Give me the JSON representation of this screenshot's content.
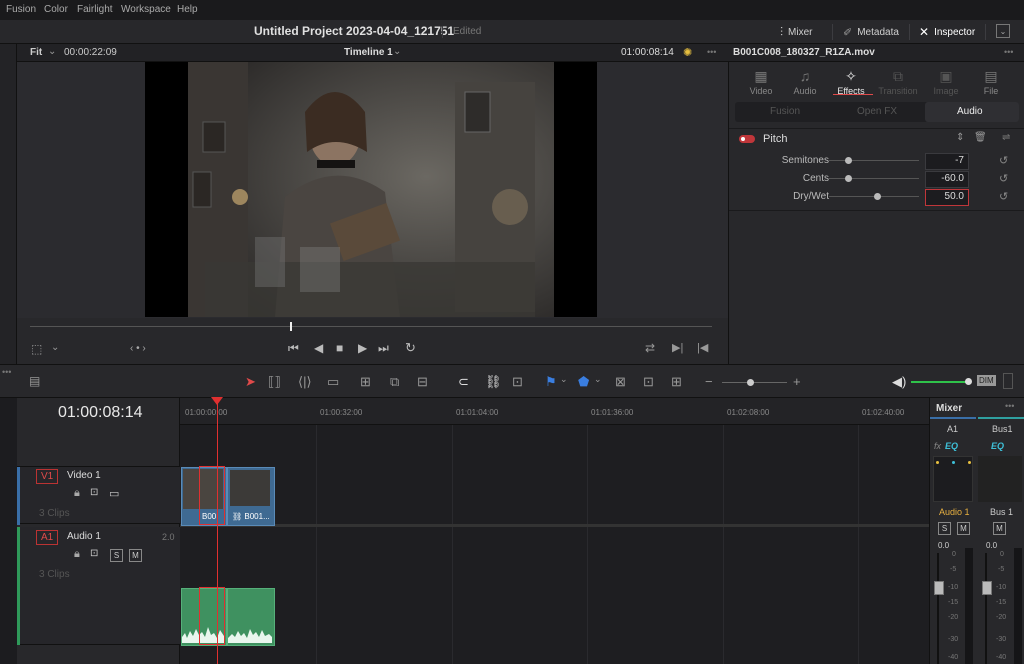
{
  "menu": [
    "Fusion",
    "Color",
    "Fairlight",
    "Workspace",
    "Help"
  ],
  "project": {
    "title": "Untitled Project 2023-04-04_121751",
    "status": "Edited"
  },
  "top_buttons": {
    "mixer": "Mixer",
    "metadata": "Metadata",
    "inspector": "Inspector"
  },
  "viewer": {
    "zoom": "Fit",
    "source_tc": "00:00:22:09",
    "timeline_name": "Timeline 1",
    "record_tc": "01:00:08:14"
  },
  "inspector": {
    "clip_name": "B001C008_180327_R1ZA.mov",
    "tabs": [
      {
        "label": "Video",
        "icon": "video-icon"
      },
      {
        "label": "Audio",
        "icon": "audio-note-icon"
      },
      {
        "label": "Effects",
        "icon": "magic-wand-icon"
      },
      {
        "label": "Transition",
        "icon": "transition-icon"
      },
      {
        "label": "Image",
        "icon": "image-icon"
      },
      {
        "label": "File",
        "icon": "file-icon"
      }
    ],
    "subtabs": [
      "Fusion",
      "Open FX",
      "Audio"
    ],
    "effect": "Pitch",
    "params": [
      {
        "label": "Semitones",
        "value": "-7",
        "level": 0.18
      },
      {
        "label": "Cents",
        "value": "-60.0",
        "level": 0.18
      },
      {
        "label": "Dry/Wet",
        "value": "50.0",
        "level": 0.5
      }
    ]
  },
  "timeline": {
    "timecode": "01:00:08:14",
    "ruler": [
      "01:00:00:00",
      "01:00:32:00",
      "01:01:04:00",
      "01:01:36:00",
      "01:02:08:00",
      "01:02:40:00"
    ],
    "video_track": {
      "id": "V1",
      "name": "Video 1",
      "clips_count": "3 Clips",
      "clip_labels": [
        "B00",
        "B001..."
      ]
    },
    "audio_track": {
      "id": "A1",
      "name": "Audio 1",
      "channels": "2.0",
      "clips_count": "3 Clips",
      "s": "S",
      "m": "M"
    }
  },
  "mixer": {
    "title": "Mixer",
    "channels": [
      "A1",
      "Bus1"
    ],
    "fx": "fx",
    "eq": "EQ",
    "strips": [
      "Audio 1",
      "Bus 1"
    ],
    "s": "S",
    "m": "M",
    "levels": [
      "0.0",
      "0.0"
    ],
    "scale": [
      "0",
      "-5",
      "-10",
      "-15",
      "-20",
      "-30",
      "-40"
    ]
  },
  "dim": "DIM",
  "colors": {
    "accent_red": "#e04a4a",
    "clip_video": "#3f6a92",
    "clip_audio": "#3f9160",
    "playhead": "#e03030"
  }
}
